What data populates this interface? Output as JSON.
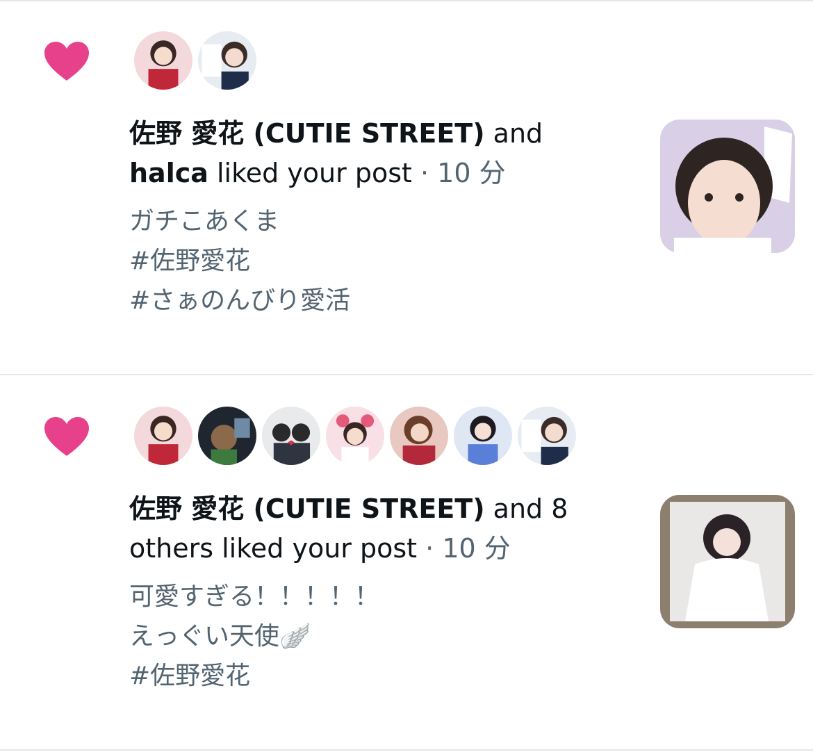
{
  "colors": {
    "heart": "#e8418b",
    "text": "#0f1419",
    "secondary": "#536471",
    "divider": "#e4e6e9"
  },
  "notifications": [
    {
      "icon": "heart-icon",
      "name_primary": "佐野 愛花 (CUTIE STREET)",
      "joiner": " and ",
      "name_secondary": "halca",
      "action": " liked your post",
      "dot": " · ",
      "time": "10 分",
      "post_lines": [
        "ガチこあくま",
        "",
        "#佐野愛花",
        "#さぁのんびり愛活"
      ],
      "avatar_count": 2
    },
    {
      "icon": "heart-icon",
      "name_primary": "佐野 愛花 (CUTIE STREET)",
      "action": " and 8 others liked your post",
      "dot": " · ",
      "time": "10 分",
      "post_lines": [
        "可愛すぎる！！！！！",
        "えっぐい天使🪽",
        "",
        "#佐野愛花"
      ],
      "avatar_count": 7
    }
  ]
}
